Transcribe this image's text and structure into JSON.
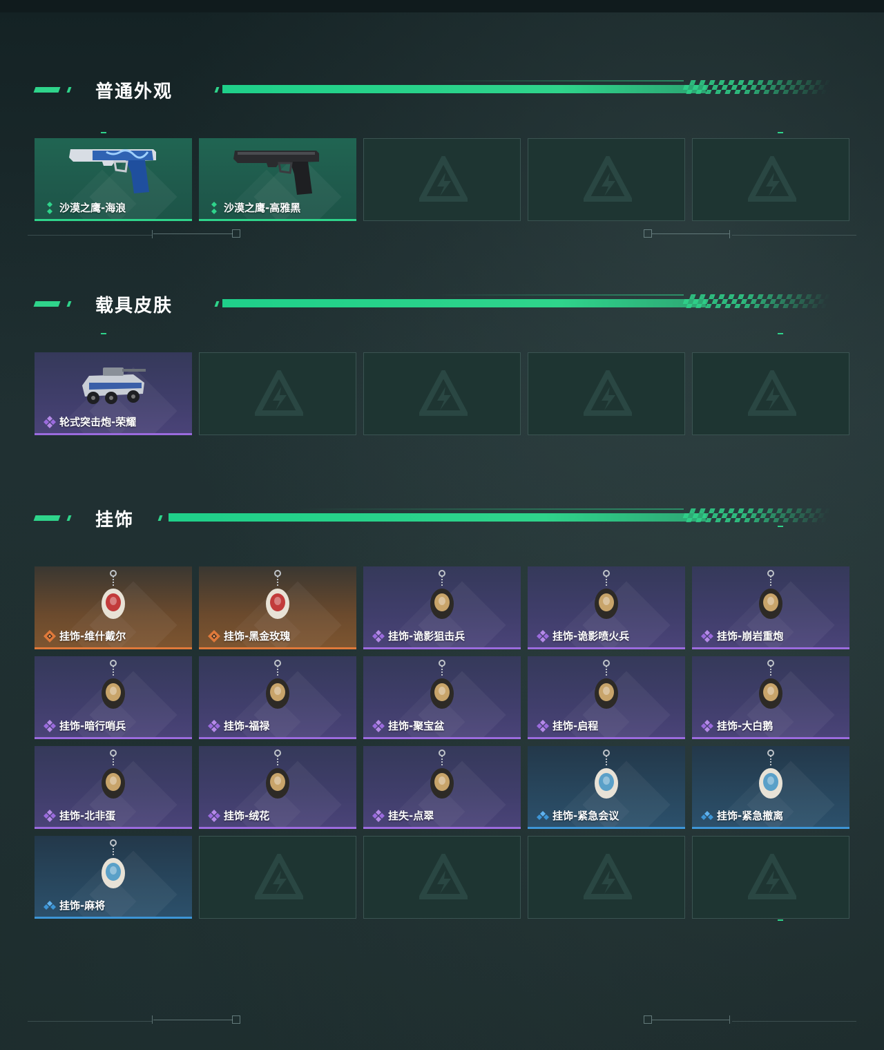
{
  "sections": [
    {
      "title": "普通外观",
      "items": [
        {
          "name": "沙漠之鹰-海浪",
          "rarity": "green",
          "art": "pistol-blue-icon"
        },
        {
          "name": "沙漠之鹰-高雅黑",
          "rarity": "green",
          "art": "pistol-black-icon"
        },
        {
          "empty": true
        },
        {
          "empty": true
        },
        {
          "empty": true
        }
      ]
    },
    {
      "title": "载具皮肤",
      "items": [
        {
          "name": "轮式突击炮-荣耀",
          "rarity": "purple",
          "art": "armored-vehicle-icon"
        },
        {
          "empty": true
        },
        {
          "empty": true
        },
        {
          "empty": true
        },
        {
          "empty": true
        }
      ]
    },
    {
      "title": "挂饰",
      "items": [
        {
          "name": "挂饰-维什戴尔",
          "rarity": "orange",
          "art": "charm-card-icon"
        },
        {
          "name": "挂饰-黑金玫瑰",
          "rarity": "orange",
          "art": "charm-rose-emblem-icon"
        },
        {
          "name": "挂饰-诡影狙击兵",
          "rarity": "purple",
          "art": "charm-sniper-icon"
        },
        {
          "name": "挂饰-诡影喷火兵",
          "rarity": "purple",
          "art": "charm-flamer-icon"
        },
        {
          "name": "挂饰-崩岩重炮",
          "rarity": "purple",
          "art": "charm-rock-icon"
        },
        {
          "name": "挂饰-暗行哨兵",
          "rarity": "purple",
          "art": "charm-sentry-icon"
        },
        {
          "name": "挂饰-福禄",
          "rarity": "purple",
          "art": "charm-gourd-icon"
        },
        {
          "name": "挂饰-聚宝盆",
          "rarity": "purple",
          "art": "charm-treasure-icon"
        },
        {
          "name": "挂饰-启程",
          "rarity": "purple",
          "art": "charm-ring-icon"
        },
        {
          "name": "挂饰-大白鹅",
          "rarity": "purple",
          "art": "charm-goose-icon"
        },
        {
          "name": "挂饰-北非蛋",
          "rarity": "purple",
          "art": "charm-shakshuka-icon"
        },
        {
          "name": "挂饰-绒花",
          "rarity": "purple",
          "art": "charm-flower-icon"
        },
        {
          "name": "挂失-点翠",
          "rarity": "purple",
          "art": "charm-phoenix-icon"
        },
        {
          "name": "挂饰-紧急会议",
          "rarity": "blue",
          "art": "charm-meeting-icon"
        },
        {
          "name": "挂饰-紧急撤离",
          "rarity": "blue",
          "art": "charm-exit-icon"
        },
        {
          "name": "挂饰-麻将",
          "rarity": "blue",
          "art": "charm-mahjong-icon"
        },
        {
          "empty": true
        },
        {
          "empty": true
        },
        {
          "empty": true
        },
        {
          "empty": true
        }
      ]
    }
  ],
  "colors": {
    "accent": "#2fd48b",
    "green": "#2fd48b",
    "purple": "#9b6bde",
    "orange": "#e0793a",
    "blue": "#3d95d6",
    "empty_bg": "#1e3532"
  }
}
